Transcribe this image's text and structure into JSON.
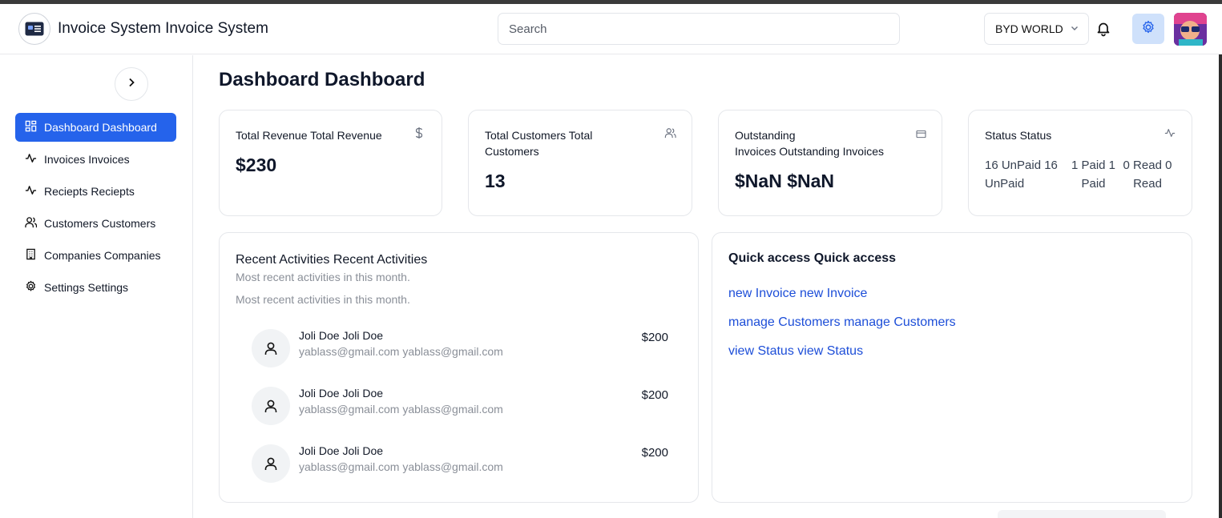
{
  "app": {
    "title": "Invoice System Invoice System"
  },
  "header": {
    "search_placeholder": "Search",
    "company": "BYD WORLD",
    "icons": [
      "invoice-logo-icon",
      "chevron-down-icon",
      "bell-icon",
      "gear-icon",
      "avatar"
    ]
  },
  "sidebar": {
    "items": [
      {
        "label": "Dashboard Dashboard",
        "icon": "dashboard-icon",
        "active": true
      },
      {
        "label": "Invoices Invoices",
        "icon": "activity-icon",
        "active": false
      },
      {
        "label": "Reciepts Reciepts",
        "icon": "activity-icon",
        "active": false
      },
      {
        "label": "Customers Customers",
        "icon": "users-icon",
        "active": false
      },
      {
        "label": "Companies Companies",
        "icon": "building-icon",
        "active": false
      },
      {
        "label": "Settings Settings",
        "icon": "gear-icon",
        "active": false
      }
    ]
  },
  "main": {
    "title": "Dashboard Dashboard"
  },
  "cards": {
    "revenue": {
      "title": "Total Revenue Total Revenue",
      "value": "$230",
      "icon": "dollar-icon"
    },
    "customers": {
      "title_line1": "Total Customers Total",
      "title_line2": "Customers",
      "value": "13",
      "icon": "users-icon"
    },
    "outstanding": {
      "title_line1": "Outstanding",
      "title_line2": "Invoices Outstanding Invoices",
      "value": "$NaN $NaN",
      "icon": "card-icon"
    },
    "status": {
      "title": "Status Status",
      "icon": "activity-icon",
      "cells": [
        {
          "line1": "16 UnPaid 16",
          "line2": "UnPaid"
        },
        {
          "line1": "1 Paid 1",
          "line2": "Paid"
        },
        {
          "line1": "0 Read 0",
          "line2": "Read"
        }
      ]
    }
  },
  "activities": {
    "title": "Recent Activities Recent Activities",
    "subtitle1": "Most recent activities in this month.",
    "subtitle2": "Most recent activities in this month.",
    "items": [
      {
        "name": "Joli Doe Joli Doe",
        "email": "yablass@gmail.com yablass@gmail.com",
        "amount": "$200"
      },
      {
        "name": "Joli Doe Joli Doe",
        "email": "yablass@gmail.com yablass@gmail.com",
        "amount": "$200"
      },
      {
        "name": "Joli Doe Joli Doe",
        "email": "yablass@gmail.com yablass@gmail.com",
        "amount": "$200"
      }
    ]
  },
  "quick_access": {
    "title": "Quick access Quick access",
    "links": [
      "new Invoice new Invoice",
      "manage Customers manage Customers",
      "view Status view Status"
    ]
  },
  "colors": {
    "accent": "#2563eb",
    "link": "#1d4ed8",
    "muted": "#8a8f98",
    "gear_bg": "#cfe1fb"
  }
}
